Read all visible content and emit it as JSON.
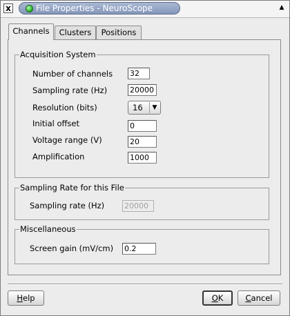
{
  "window": {
    "title": "File Properties - NeuroScope",
    "close_glyph": "x",
    "shade_glyph": "▲"
  },
  "tabs": [
    {
      "label": "Channels",
      "active": true
    },
    {
      "label": "Clusters",
      "active": false
    },
    {
      "label": "Positions",
      "active": false
    }
  ],
  "acquisition": {
    "legend": "Acquisition System",
    "num_channels_label": "Number of channels",
    "num_channels_value": "32",
    "sampling_rate_label": "Sampling rate (Hz)",
    "sampling_rate_value": "20000",
    "resolution_label": "Resolution (bits)",
    "resolution_value": "16",
    "initial_offset_label": "Initial offset",
    "initial_offset_value": "0",
    "voltage_range_label": "Voltage range (V)",
    "voltage_range_value": "20",
    "amplification_label": "Amplification",
    "amplification_value": "1000"
  },
  "file_sampling": {
    "legend": "Sampling Rate for this File",
    "sampling_rate_label": "Sampling rate (Hz)",
    "sampling_rate_value": "20000"
  },
  "misc": {
    "legend": "Miscellaneous",
    "screen_gain_label": "Screen gain (mV/cm)",
    "screen_gain_value": "0.2"
  },
  "buttons": {
    "help_mnemonic": "H",
    "help_rest": "elp",
    "ok_mnemonic": "O",
    "ok_rest": "K",
    "cancel_mnemonic": "C",
    "cancel_rest": "ancel"
  }
}
